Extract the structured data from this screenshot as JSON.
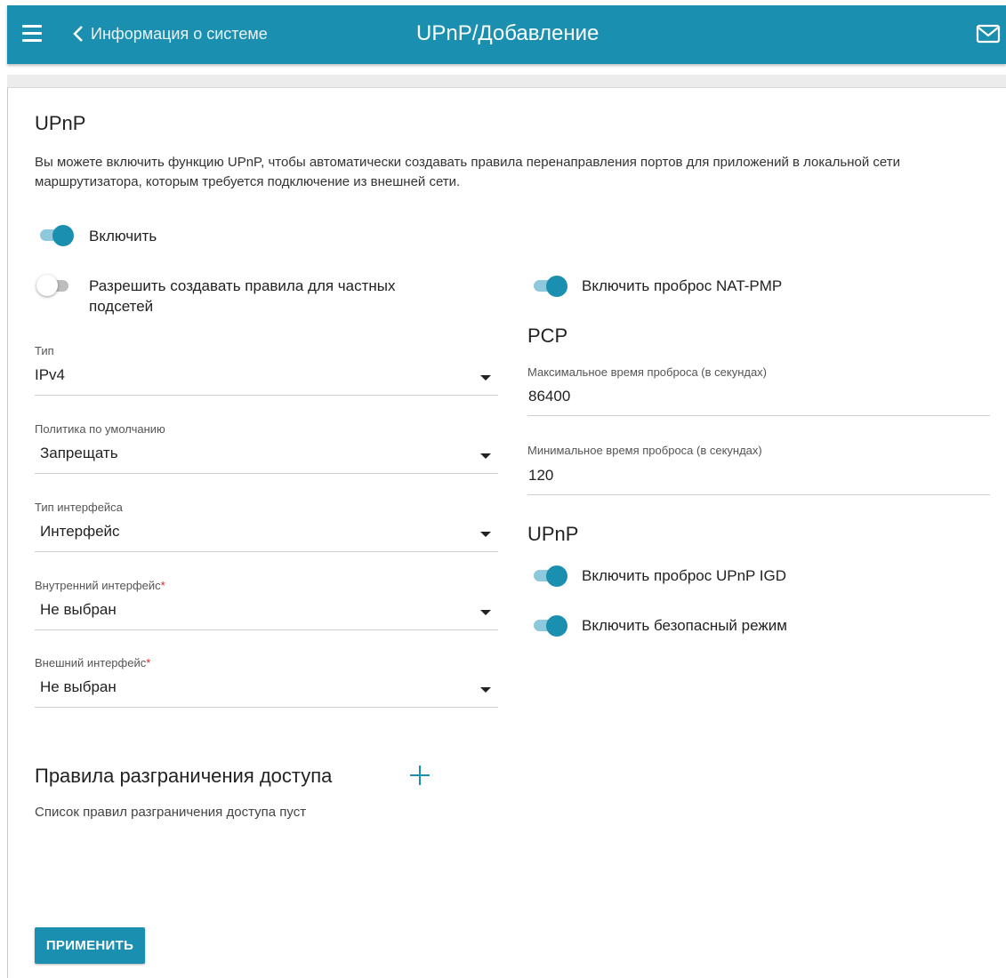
{
  "header": {
    "back_label": "Информация о системе",
    "title": "UPnP/Добавление",
    "menu_icon": "hamburger-icon",
    "back_icon": "chevron-left-icon",
    "mail_icon": "envelope-icon"
  },
  "upnp_section": {
    "title": "UPnP",
    "description": "Вы можете включить функцию UPnP, чтобы автоматически создавать правила перенаправления портов для приложений в локальной сети маршрутизатора, которым требуется подключение из внешней сети."
  },
  "toggles": {
    "enable": {
      "label": "Включить",
      "on": true
    },
    "private_subnets": {
      "label": "Разрешить создавать правила для частных подсетей",
      "on": false
    },
    "nat_pmp": {
      "label": "Включить проброс NAT-PMP",
      "on": true
    },
    "upnp_igd": {
      "label": "Включить проброс UPnP IGD",
      "on": true
    },
    "secure_mode": {
      "label": "Включить безопасный режим",
      "on": true
    }
  },
  "fields": {
    "type": {
      "label": "Тип",
      "value": "IPv4"
    },
    "default_policy": {
      "label": "Политика по умолчанию",
      "value": "Запрещать"
    },
    "interface_type": {
      "label": "Тип интерфейса",
      "value": "Интерфейс"
    },
    "internal_interface": {
      "label": "Внутренний интерфейс",
      "required": "*",
      "value": "Не выбран"
    },
    "external_interface": {
      "label": "Внешний интерфейс",
      "required": "*",
      "value": "Не выбран"
    }
  },
  "pcp": {
    "title": "PCP",
    "max_time": {
      "label": "Максимальное время проброса (в секундах)",
      "value": "86400"
    },
    "min_time": {
      "label": "Минимальное время проброса (в секундах)",
      "value": "120"
    }
  },
  "upnp_subsection": {
    "title": "UPnP"
  },
  "access_rules": {
    "title": "Правила разграничения доступа",
    "empty_text": "Список правил разграничения доступа пуст",
    "add_icon": "plus-icon"
  },
  "actions": {
    "apply_label": "ПРИМЕНИТЬ"
  },
  "colors": {
    "accent": "#1b8fb0",
    "required": "#e02020"
  }
}
